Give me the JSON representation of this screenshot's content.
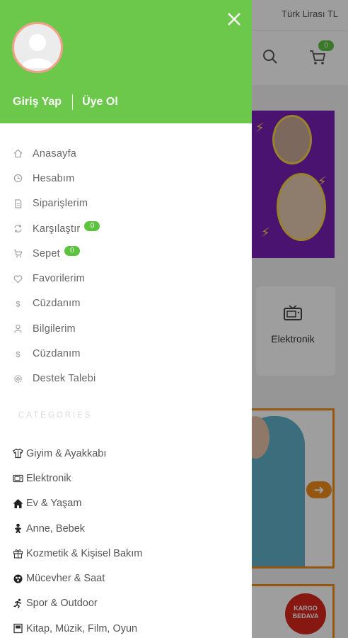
{
  "background": {
    "currency_label": "Türk Lirası TL",
    "cart_count": "0",
    "category_card_label": "Elektronik",
    "kargo_line1": "KARGO",
    "kargo_line2": "BEDAVA"
  },
  "drawer": {
    "login_label": "Giriş Yap",
    "register_label": "Üye Ol",
    "menu": [
      {
        "label": "Anasayfa",
        "icon": "home-icon"
      },
      {
        "label": "Hesabım",
        "icon": "clock-icon"
      },
      {
        "label": "Siparişlerim",
        "icon": "document-icon"
      },
      {
        "label": "Karşılaştır",
        "icon": "refresh-icon",
        "badge": "0"
      },
      {
        "label": "Sepet",
        "icon": "cart-icon",
        "badge": "0"
      },
      {
        "label": "Favorilerim",
        "icon": "heart-icon"
      },
      {
        "label": "Cüzdanım",
        "icon": "dollar-icon"
      },
      {
        "label": "Bilgilerim",
        "icon": "user-icon"
      },
      {
        "label": "Cüzdanım",
        "icon": "dollar-icon"
      },
      {
        "label": "Destek Talebi",
        "icon": "settings-icon"
      }
    ],
    "categories_heading": "CATEGORIES",
    "categories": [
      {
        "label": "Giyim & Ayakkabı",
        "icon": "shirt-icon"
      },
      {
        "label": "Elektronik",
        "icon": "tv-icon"
      },
      {
        "label": "Ev & Yaşam",
        "icon": "house-icon"
      },
      {
        "label": "Anne, Bebek",
        "icon": "baby-icon"
      },
      {
        "label": "Kozmetik & Kişisel Bakım",
        "icon": "gift-icon"
      },
      {
        "label": "Mücevher & Saat",
        "icon": "gem-icon"
      },
      {
        "label": "Spor & Outdoor",
        "icon": "runner-icon"
      },
      {
        "label": "Kitap, Müzik, Film, Oyun",
        "icon": "book-icon"
      }
    ]
  },
  "colors": {
    "drawer_header": "#6cc84a",
    "badge": "#5cc33f",
    "promo_border": "#f08c1b",
    "banner": "#7a1fb5"
  }
}
